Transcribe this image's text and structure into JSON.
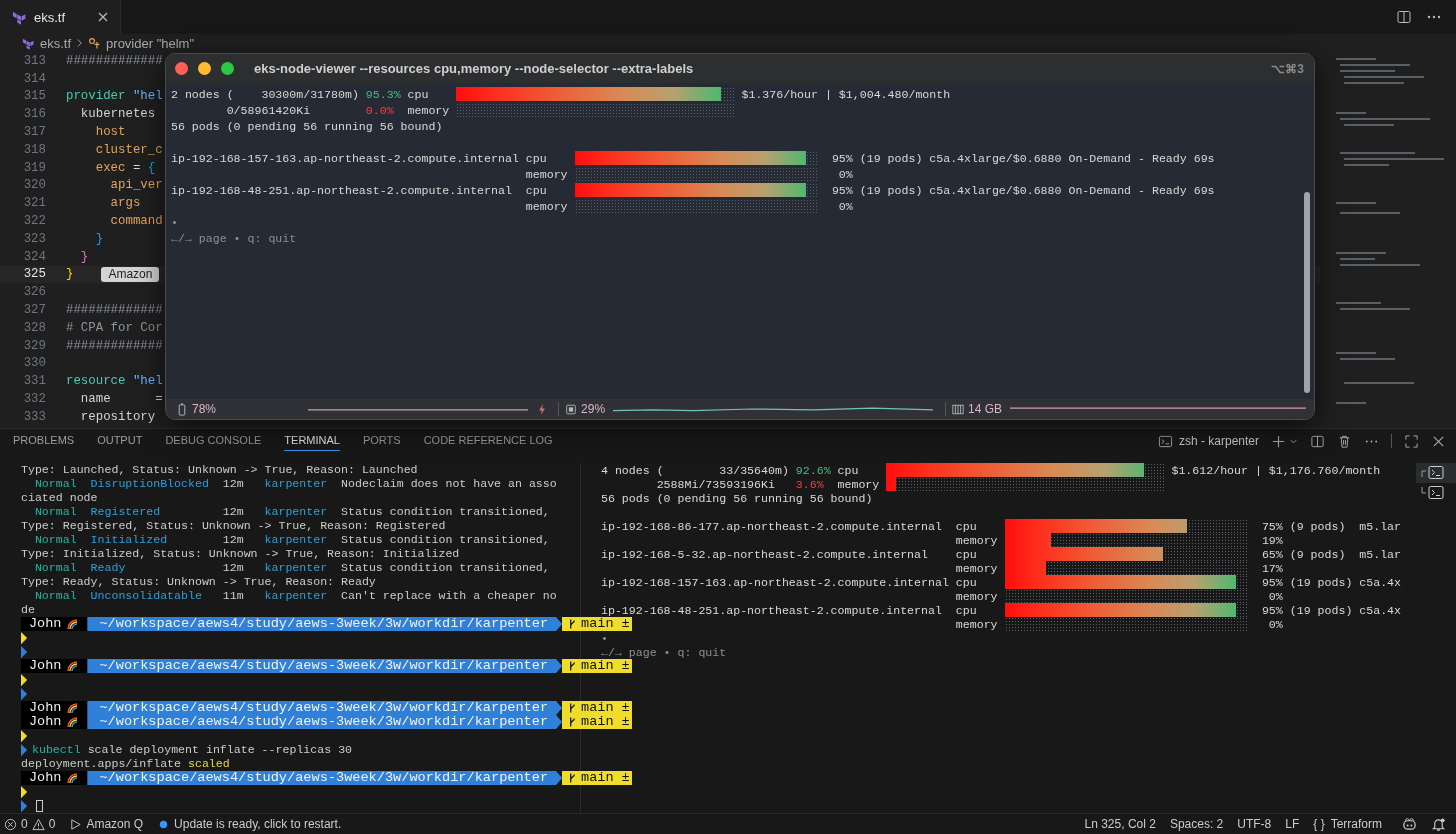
{
  "editor": {
    "tab": {
      "label": "eks.tf",
      "selected": true
    },
    "breadcrumbs": [
      "eks.tf",
      "provider \"helm\""
    ],
    "lines": [
      {
        "number": "313",
        "current": false,
        "segments": [
          {
            "text": "#############",
            "kind": "com"
          }
        ]
      },
      {
        "number": "314",
        "current": false
      },
      {
        "number": "315",
        "current": false,
        "segments": [
          {
            "text": "provider ",
            "kind": "kw"
          },
          {
            "text": "\"hel",
            "kind": "str"
          }
        ]
      },
      {
        "number": "316",
        "current": false,
        "segments": [
          {
            "text": "  kubernetes",
            "kind": "plain"
          }
        ]
      },
      {
        "number": "317",
        "current": false,
        "segments": [
          {
            "text": "    host",
            "kind": "attr"
          }
        ]
      },
      {
        "number": "318",
        "current": false,
        "segments": [
          {
            "text": "    cluster_c",
            "kind": "attr"
          }
        ]
      },
      {
        "number": "319",
        "current": false,
        "segments": [
          {
            "text": "    exec",
            "kind": "attr"
          },
          {
            "text": " = ",
            "kind": "plain"
          },
          {
            "text": "{",
            "kind": "b3"
          }
        ]
      },
      {
        "number": "320",
        "current": false,
        "segments": [
          {
            "text": "      api_ver",
            "kind": "attr"
          }
        ]
      },
      {
        "number": "321",
        "current": false,
        "segments": [
          {
            "text": "      args",
            "kind": "attr"
          }
        ]
      },
      {
        "number": "322",
        "current": false,
        "segments": [
          {
            "text": "      command",
            "kind": "attr"
          }
        ]
      },
      {
        "number": "323",
        "current": false,
        "segments": [
          {
            "text": "    }",
            "kind": "b3"
          }
        ]
      },
      {
        "number": "324",
        "current": false,
        "segments": [
          {
            "text": "  }",
            "kind": "b2"
          }
        ]
      },
      {
        "number": "325",
        "current": true,
        "segments": [
          {
            "text": "}",
            "kind": "b1"
          }
        ],
        "hint": "Amazon"
      },
      {
        "number": "326",
        "current": false
      },
      {
        "number": "327",
        "current": false,
        "segments": [
          {
            "text": "#############",
            "kind": "com"
          }
        ]
      },
      {
        "number": "328",
        "current": false,
        "segments": [
          {
            "text": "# CPA for Cor",
            "kind": "com"
          }
        ]
      },
      {
        "number": "329",
        "current": false,
        "segments": [
          {
            "text": "#############",
            "kind": "com"
          }
        ]
      },
      {
        "number": "330",
        "current": false
      },
      {
        "number": "331",
        "current": false,
        "segments": [
          {
            "text": "resource ",
            "kind": "kw"
          },
          {
            "text": "\"hel",
            "kind": "str"
          }
        ]
      },
      {
        "number": "332",
        "current": false,
        "segments": [
          {
            "text": "  name      =",
            "kind": "plain"
          }
        ]
      },
      {
        "number": "333",
        "current": false,
        "segments": [
          {
            "text": "  repository",
            "kind": "plain"
          }
        ]
      }
    ]
  },
  "floating_terminal": {
    "title": "eks-node-viewer --resources cpu,memory --node-selector  --extra-labels",
    "shortcut": "⌥⌘3",
    "viewer": {
      "summary": {
        "cpu": {
          "text": "2 nodes (    30300m/31780m)",
          "pct": "95.3%",
          "label": "cpu",
          "level": 0.953
        },
        "cost": "$1.376/hour | $1,004.480/month",
        "memory": {
          "text": "0/58961420Ki",
          "pct": "0.0%",
          "label": "memory",
          "level": 0
        },
        "pods": "56 pods (0 pending 56 running 56 bound)"
      },
      "nodes": [
        {
          "name": "ip-192-168-157-163.ap-northeast-2.compute.internal",
          "cpu": {
            "label": "cpu",
            "level": 0.95,
            "pct": "95%",
            "detail": "(19 pods) c5a.4xlarge/$0.6880 On-Demand - Ready 69s"
          },
          "memory": {
            "label": "memory",
            "level": 0,
            "pct": "0%"
          }
        },
        {
          "name": "ip-192-168-48-251.ap-northeast-2.compute.internal",
          "cpu": {
            "label": "cpu",
            "level": 0.95,
            "pct": "95%",
            "detail": "(19 pods) c5a.4xlarge/$0.6880 On-Demand - Ready 69s"
          },
          "memory": {
            "label": "memory",
            "level": 0,
            "pct": "0%"
          }
        }
      ],
      "bullet": "•",
      "help": "←/→ page • q: quit"
    },
    "status": {
      "battery": "78%",
      "cpu": "29%",
      "memory": "14 GB"
    }
  },
  "panel": {
    "tabs": [
      {
        "label": "PROBLEMS",
        "selected": false
      },
      {
        "label": "OUTPUT",
        "selected": false
      },
      {
        "label": "DEBUG CONSOLE",
        "selected": false
      },
      {
        "label": "TERMINAL",
        "selected": true
      },
      {
        "label": "PORTS",
        "selected": false
      },
      {
        "label": "CODE REFERENCE LOG",
        "selected": false
      }
    ],
    "terminal_name": "zsh - karpenter",
    "left_terminal": [
      {
        "kind": "text",
        "segments": [
          {
            "text": "Type: Launched, Status: Unknown -> True, Reason: Launched",
            "kind": "plain"
          }
        ]
      },
      {
        "kind": "text",
        "segments": [
          {
            "text": "  Normal  ",
            "kind": "teal"
          },
          {
            "text": "DisruptionBlocked  ",
            "kind": "blue"
          },
          {
            "text": "12m   ",
            "kind": "plain"
          },
          {
            "text": "karpenter  ",
            "kind": "blue"
          },
          {
            "text": "Nodeclaim does not have an asso",
            "kind": "plain"
          }
        ]
      },
      {
        "kind": "text",
        "segments": [
          {
            "text": "ciated node",
            "kind": "plain"
          }
        ]
      },
      {
        "kind": "text",
        "segments": [
          {
            "text": "  Normal  ",
            "kind": "teal"
          },
          {
            "text": "Registered         ",
            "kind": "blue"
          },
          {
            "text": "12m   ",
            "kind": "plain"
          },
          {
            "text": "karpenter  ",
            "kind": "blue"
          },
          {
            "text": "Status condition transitioned,",
            "kind": "plain"
          }
        ]
      },
      {
        "kind": "text",
        "segments": [
          {
            "text": "Type: Registered, Status: Unknown -> True, Reason: Registered",
            "kind": "plain"
          }
        ]
      },
      {
        "kind": "text",
        "segments": [
          {
            "text": "  Normal  ",
            "kind": "teal"
          },
          {
            "text": "Initialized        ",
            "kind": "blue"
          },
          {
            "text": "12m   ",
            "kind": "plain"
          },
          {
            "text": "karpenter  ",
            "kind": "blue"
          },
          {
            "text": "Status condition transitioned,",
            "kind": "plain"
          }
        ]
      },
      {
        "kind": "text",
        "segments": [
          {
            "text": "Type: Initialized, Status: Unknown -> True, Reason: Initialized",
            "kind": "plain"
          }
        ]
      },
      {
        "kind": "text",
        "segments": [
          {
            "text": "  Normal  ",
            "kind": "teal"
          },
          {
            "text": "Ready              ",
            "kind": "blue"
          },
          {
            "text": "12m   ",
            "kind": "plain"
          },
          {
            "text": "karpenter  ",
            "kind": "blue"
          },
          {
            "text": "Status condition transitioned,",
            "kind": "plain"
          }
        ]
      },
      {
        "kind": "text",
        "segments": [
          {
            "text": "Type: Ready, Status: Unknown -> True, Reason: Ready",
            "kind": "plain"
          }
        ]
      },
      {
        "kind": "text",
        "segments": [
          {
            "text": "  Normal  ",
            "kind": "teal"
          },
          {
            "text": "Unconsolidatable   ",
            "kind": "blue"
          },
          {
            "text": "11m   ",
            "kind": "plain"
          },
          {
            "text": "karpenter  ",
            "kind": "blue"
          },
          {
            "text": "Can't replace with a cheaper no",
            "kind": "plain"
          }
        ]
      },
      {
        "kind": "text",
        "segments": [
          {
            "text": "de",
            "kind": "plain"
          }
        ]
      },
      {
        "kind": "prompt",
        "user": "John",
        "path": "~/workspace/aews4/study/aews-3week/3w/workdir/karpenter",
        "branch": "main ±"
      },
      {
        "kind": "chevron",
        "color": "#f0dc2a",
        "cursor": false
      },
      {
        "kind": "chevron",
        "color": "#2f80d8",
        "cursor": false
      },
      {
        "kind": "prompt",
        "user": "John",
        "path": "~/workspace/aews4/study/aews-3week/3w/workdir/karpenter",
        "branch": "main ±"
      },
      {
        "kind": "chevron",
        "color": "#f0dc2a",
        "cursor": false
      },
      {
        "kind": "chevron",
        "color": "#2f80d8",
        "cursor": false
      },
      {
        "kind": "prompt",
        "user": "John",
        "path": "~/workspace/aews4/study/aews-3week/3w/workdir/karpenter",
        "branch": "main ±"
      },
      {
        "kind": "prompt",
        "user": "John",
        "path": "~/workspace/aews4/study/aews-3week/3w/workdir/karpenter",
        "branch": "main ±"
      },
      {
        "kind": "chevron",
        "color": "#f0dc2a",
        "cursor": false
      },
      {
        "kind": "chevron",
        "color": "#2f80d8",
        "cursor": false,
        "segments": [
          {
            "text": "kubectl",
            "kind": "teal"
          },
          {
            "text": " scale deployment inflate --replicas 30",
            "kind": "plain"
          }
        ]
      },
      {
        "kind": "text",
        "segments": [
          {
            "text": "deployment.apps/inflate ",
            "kind": "plain"
          },
          {
            "text": "scaled",
            "kind": "yellow"
          }
        ]
      },
      {
        "kind": "prompt",
        "user": "John",
        "path": "~/workspace/aews4/study/aews-3week/3w/workdir/karpenter",
        "branch": "main ±"
      },
      {
        "kind": "chevron",
        "color": "#f0dc2a",
        "cursor": false
      },
      {
        "kind": "chevron",
        "color": "#2f80d8",
        "cursor": true
      }
    ],
    "right_viewer": {
      "summary": {
        "cpu": {
          "text": "4 nodes (        33/35640m)",
          "pct": "92.6%",
          "label": "cpu",
          "level": 0.926
        },
        "cost": "$1.612/hour | $1,176.760/month",
        "memory": {
          "text": "2588Mi/73593196Ki",
          "pct": "3.6%",
          "label": "memory",
          "level": 0.036
        },
        "pods": "56 pods (0 pending 56 running 56 bound)"
      },
      "nodes": [
        {
          "name": "ip-192-168-86-177.ap-northeast-2.compute.internal",
          "cpu": {
            "label": "cpu",
            "level": 0.75,
            "pct": "75%",
            "detail": "(9 pods)  m5.lar"
          },
          "memory": {
            "label": "memory",
            "level": 0.19,
            "pct": "19%"
          }
        },
        {
          "name": "ip-192-168-5-32.ap-northeast-2.compute.internal",
          "cpu": {
            "label": "cpu",
            "level": 0.65,
            "pct": "65%",
            "detail": "(9 pods)  m5.lar"
          },
          "memory": {
            "label": "memory",
            "level": 0.17,
            "pct": "17%"
          }
        },
        {
          "name": "ip-192-168-157-163.ap-northeast-2.compute.internal",
          "cpu": {
            "label": "cpu",
            "level": 0.95,
            "pct": "95%",
            "detail": "(19 pods) c5a.4x"
          },
          "memory": {
            "label": "memory",
            "level": 0,
            "pct": "0%"
          }
        },
        {
          "name": "ip-192-168-48-251.ap-northeast-2.compute.internal",
          "cpu": {
            "label": "cpu",
            "level": 0.95,
            "pct": "95%",
            "detail": "(19 pods) c5a.4x"
          },
          "memory": {
            "label": "memory",
            "level": 0,
            "pct": "0%"
          }
        }
      ],
      "bullet": "•",
      "help": "←/→ page • q: quit"
    },
    "terminal_list": [
      {
        "selected": true
      },
      {
        "selected": false
      }
    ]
  },
  "status_bar": {
    "errors": "0",
    "warnings": "0",
    "amazon_q": "Amazon Q",
    "update": "Update is ready, click to restart.",
    "position": "Ln 325, Col 2",
    "spaces": "Spaces: 2",
    "encoding": "UTF-8",
    "eol": "LF",
    "language_icon": "{ }",
    "language": "Terraform"
  }
}
